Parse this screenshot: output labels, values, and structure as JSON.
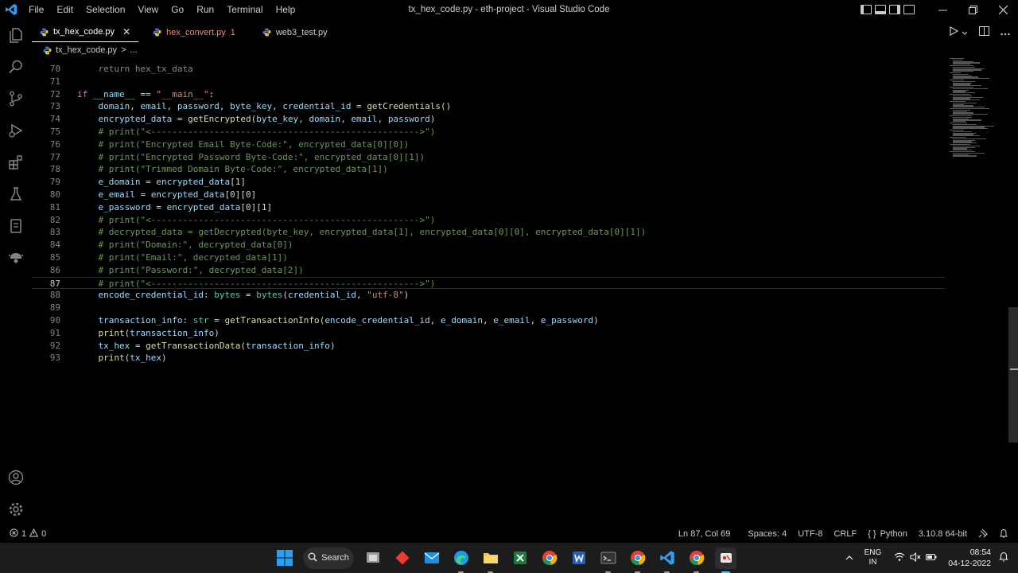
{
  "window": {
    "title": "tx_hex_code.py - eth-project - Visual Studio Code",
    "menu": [
      "File",
      "Edit",
      "Selection",
      "View",
      "Go",
      "Run",
      "Terminal",
      "Help"
    ]
  },
  "tabs": [
    {
      "label": "tx_hex_code.py",
      "active": true,
      "close": "✕"
    },
    {
      "label": "hex_convert.py",
      "badge": "1",
      "error": true
    },
    {
      "label": "web3_test.py"
    }
  ],
  "breadcrumb": {
    "file": "tx_hex_code.py",
    "sep": ">",
    "more": "..."
  },
  "code": {
    "current_line": 87,
    "lines": [
      {
        "n": "70",
        "text": ""
      },
      {
        "n": "71",
        "text": ""
      },
      {
        "n": "72",
        "text": "if __name__ == \"__main__\":"
      },
      {
        "n": "73",
        "text": "    domain, email, password, byte_key, credential_id = getCredentials()"
      },
      {
        "n": "74",
        "text": "    encrypted_data = getEncrypted(byte_key, domain, email, password)"
      },
      {
        "n": "75",
        "text": "    # print(\"<--------------------------------------------------->\")"
      },
      {
        "n": "76",
        "text": "    # print(\"Encrypted Email Byte-Code:\", encrypted_data[0][0])"
      },
      {
        "n": "77",
        "text": "    # print(\"Encrypted Password Byte-Code:\", encrypted_data[0][1])"
      },
      {
        "n": "78",
        "text": "    # print(\"Trimmed Domain Byte-Code:\", encrypted_data[1])"
      },
      {
        "n": "79",
        "text": "    e_domain = encrypted_data[1]"
      },
      {
        "n": "80",
        "text": "    e_email = encrypted_data[0][0]"
      },
      {
        "n": "81",
        "text": "    e_password = encrypted_data[0][1]"
      },
      {
        "n": "82",
        "text": "    # print(\"<--------------------------------------------------->\")"
      },
      {
        "n": "83",
        "text": "    # decrypted_data = getDecrypted(byte_key, encrypted_data[1], encrypted_data[0][0], encrypted_data[0][1])"
      },
      {
        "n": "84",
        "text": "    # print(\"Domain:\", decrypted_data[0])"
      },
      {
        "n": "85",
        "text": "    # print(\"Email:\", decrypted_data[1])"
      },
      {
        "n": "86",
        "text": "    # print(\"Password:\", decrypted_data[2])"
      },
      {
        "n": "87",
        "text": "    # print(\"<--------------------------------------------------->\")"
      },
      {
        "n": "88",
        "text": "    encode_credential_id: bytes = bytes(credential_id, \"utf-8\")"
      },
      {
        "n": "89",
        "text": ""
      },
      {
        "n": "90",
        "text": "    transaction_info: str = getTransactionInfo(encode_credential_id, e_domain, e_email, e_password)"
      },
      {
        "n": "91",
        "text": "    print(transaction_info)"
      },
      {
        "n": "92",
        "text": "    tx_hex = getTransactionData(transaction_info)"
      },
      {
        "n": "93",
        "text": "    print(tx_hex)"
      }
    ]
  },
  "statusbar": {
    "errors": "1",
    "warnings": "0",
    "position": "Ln 87, Col 69",
    "spaces": "Spaces: 4",
    "encoding": "UTF-8",
    "eol": "CRLF",
    "language_prefix": "{ }",
    "language": "Python",
    "interpreter": "3.10.8 64-bit"
  },
  "taskbar": {
    "search_label": "Search",
    "lang_top": "ENG",
    "lang_bottom": "IN",
    "time": "08:54",
    "date": "04-12-2022"
  },
  "colors": {
    "keyword": "#c586c0",
    "string": "#ce9178",
    "variable": "#9cdcfe",
    "function": "#dcdcaa",
    "comment": "#6a9955",
    "type": "#4ec9b0",
    "error_tab": "#f48771",
    "vscode_blue": "#0078d4"
  }
}
